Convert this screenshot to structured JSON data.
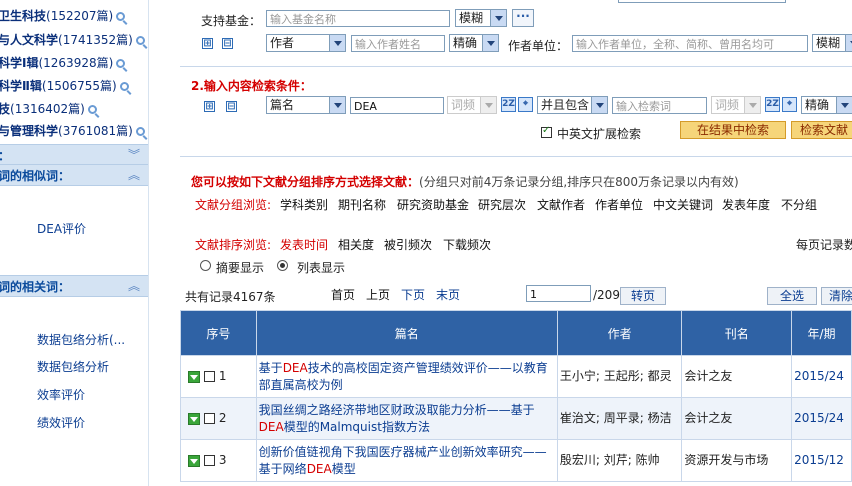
{
  "sidebar": {
    "categories": [
      {
        "name": "卫生科技",
        "count": "(152207篇)"
      },
      {
        "name": "与人文科学",
        "count": "(1741352篇)"
      },
      {
        "name": "科学Ⅰ辑",
        "count": "(1263928篇)"
      },
      {
        "name": "科学Ⅱ辑",
        "count": "(1506755篇)"
      },
      {
        "name": "技",
        "count": "(1316402篇)"
      },
      {
        "name": "与管理科学",
        "count": "(3761081篇)"
      }
    ],
    "section0_title": "：",
    "section1_title": "词的相似词：",
    "similar_words": [
      "DEA评价"
    ],
    "section2_title": "词的相关词：",
    "related_words": [
      "数据包络分析(...",
      "数据包络分析",
      "效率评价",
      "绩效评价"
    ]
  },
  "form": {
    "fund_label": "支持基金：",
    "fund_placeholder": "输入基金名称",
    "fund_match": "模糊",
    "plus": "⊞",
    "minus": "⊟",
    "author_field": "作者",
    "author_placeholder": "输入作者姓名",
    "author_match": "精确",
    "unit_label": "作者单位：",
    "unit_placeholder": "输入作者单位，全称、简称、曾用名均可",
    "unit_match": "模糊",
    "content_header": "2.输入内容检索条件：",
    "field1": "篇名",
    "value1": "DEA",
    "freq1": "词频",
    "op": "并且包含",
    "keyword_placeholder": "输入检索词",
    "freq2": "词频",
    "match2": "精确",
    "expand_label": "中英文扩展检索",
    "search_in_results": "在结果中检索",
    "search_docs": "检索文献"
  },
  "grouping": {
    "notice_bold": "您可以按如下文献分组排序方式选择文献：",
    "notice_rest": "(分组只对前4万条记录分组,排序只在800万条记录以内有效)",
    "group_label": "文献分组浏览:",
    "group_items": [
      "学科类别",
      "期刊名称",
      "研究资助基金",
      "研究层次",
      "文献作者",
      "作者单位",
      "中文关键词",
      "发表年度",
      "不分组"
    ],
    "sort_label": "文献排序浏览:",
    "sort_items": [
      "发表时间",
      "相关度",
      "被引频次",
      "下载频次"
    ],
    "per_page_label": "每页记录数",
    "view_abstract": "摘要显示",
    "view_list": "列表显示"
  },
  "pager": {
    "total": "共有记录4167条",
    "first": "首页",
    "prev": "上页",
    "next": "下页",
    "last": "末页",
    "page_value": "1",
    "page_total": "/209",
    "go": "转页",
    "select_all": "全选",
    "clear": "清除"
  },
  "table": {
    "headers": [
      "序号",
      "篇名",
      "作者",
      "刊名",
      "年/期"
    ],
    "rows": [
      {
        "no": "1",
        "title_pre": "基于",
        "title_hl": "DEA",
        "title_post": "技术的高校固定资产管理绩效评价——以教育部直属高校为例",
        "authors": "王小宁; 王起彤; 都灵",
        "journal": "会计之友",
        "issue": "2015/24"
      },
      {
        "no": "2",
        "title_pre": "我国丝绸之路经济带地区财政汲取能力分析——基于",
        "title_hl": "DEA",
        "title_post": "模型的Malmquist指数方法",
        "authors": "崔治文; 周平录; 杨洁",
        "journal": "会计之友",
        "issue": "2015/24"
      },
      {
        "no": "3",
        "title_pre": "创新价值链视角下我国医疗器械产业创新效率研究——基于网络",
        "title_hl": "DEA",
        "title_post": "模型",
        "authors": "殷宏川; 刘芹; 陈帅",
        "journal": "资源开发与市场",
        "issue": "2015/12"
      }
    ]
  },
  "colors": {
    "header_blue": "#2f62a5",
    "sidebar_bar": "#d4e3f3",
    "highlight_red": "#d40000",
    "orange_button": "#f6d57a"
  }
}
